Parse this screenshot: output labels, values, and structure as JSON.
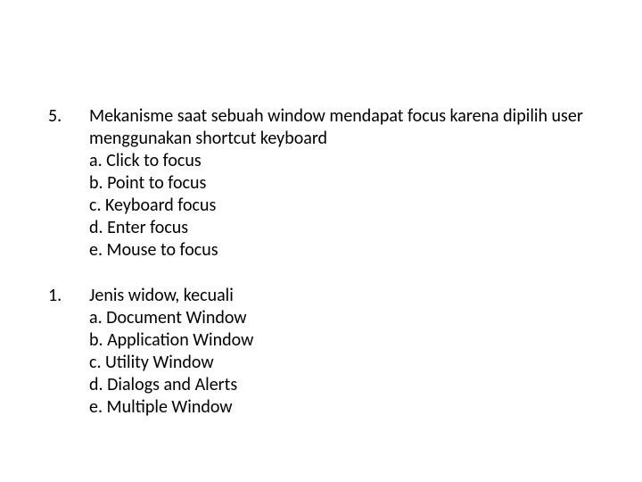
{
  "questions": [
    {
      "number": "5.",
      "text": "Mekanisme saat sebuah window mendapat focus karena dipilih user menggunakan shortcut keyboard",
      "options": [
        "a. Click to focus",
        "b. Point to focus",
        "c. Keyboard focus",
        "d. Enter focus",
        "e. Mouse to focus"
      ]
    },
    {
      "number": "1.",
      "text": "Jenis widow, kecuali",
      "options": [
        "a. Document Window",
        "b. Application Window",
        "c. Utility Window",
        "d. Dialogs and Alerts",
        "e. Multiple Window"
      ]
    }
  ]
}
